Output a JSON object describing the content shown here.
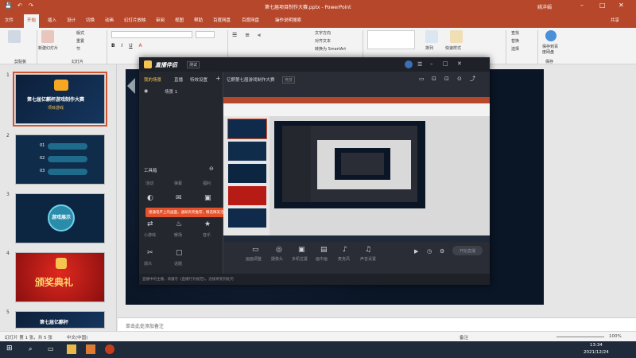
{
  "window": {
    "title": "第七届项目制作大赛.pptx - PowerPoint",
    "user": "姚洋娟"
  },
  "ribbon_tabs": [
    "文件",
    "开始",
    "插入",
    "设计",
    "切换",
    "动画",
    "幻灯片放映",
    "审阅",
    "视图",
    "帮助",
    "百度网盘",
    "百度网盘",
    "操作说明搜索"
  ],
  "ribbon_share": "共享",
  "ribbon_groups": {
    "clipboard": "剪贴板",
    "slides": "幻灯片",
    "new_slide": "新建幻灯片",
    "layout": "版式",
    "reset": "重置",
    "section": "节",
    "text_direction": "文字方向",
    "align_text": "对齐文本",
    "smartart": "转换为 SmartArt",
    "arrange": "排列",
    "quick_styles": "快速样式",
    "find": "查找",
    "replace": "替换",
    "select": "选择",
    "save_baidu": "保存到百度网盘",
    "baidu_group": "保存"
  },
  "thumbs": [
    {
      "num": "1",
      "title": "第七届亿麒杯游戏制作大赛",
      "sub": "项目游戏"
    },
    {
      "num": "2",
      "items": [
        "01",
        "02",
        "03"
      ]
    },
    {
      "num": "3",
      "title": "游戏展示"
    },
    {
      "num": "4",
      "title": "颁奖典礼"
    },
    {
      "num": "5",
      "title": "第七届亿麒杯"
    }
  ],
  "notes_placeholder": "单击此处添加备注",
  "status": {
    "slide_counter": "幻灯片 第 1 张，共 5 张",
    "language": "中文(中国)",
    "notes_label": "备注",
    "zoom": "100%"
  },
  "taskbar": {
    "time": "13:34",
    "date": "2021/12/24"
  },
  "app": {
    "logo": "直播伴侣",
    "version": "测试",
    "side_tabs": [
      "我的场景",
      "直播",
      "特效设置"
    ],
    "scene": "场景 1",
    "room_title": "亿麒第七届游戏制作大赛",
    "room_badge": "竞技",
    "toolbox_label": "工具箱",
    "tools": [
      {
        "label": "活动",
        "icon": "activity-icon"
      },
      {
        "label": "弹幕",
        "icon": "danmu-icon"
      },
      {
        "label": "福利",
        "icon": "gift-icon"
      },
      {
        "label": "小游戏",
        "icon": "game-icon"
      },
      {
        "label": "暖场",
        "icon": "warmup-icon"
      },
      {
        "label": "音乐",
        "icon": "music-icon"
      },
      {
        "label": "观众",
        "icon": "viewer-icon"
      },
      {
        "label": "话题",
        "icon": "topic-icon"
      },
      {
        "label": "分享",
        "icon": "share-icon"
      }
    ],
    "tip_banner": "接通电平上的画面，通知有奖推荐，精选精美活动收益",
    "bottom_tools": [
      "画面调整",
      "摄像头",
      "多机位置",
      "画中画",
      "麦克风",
      "声音设置"
    ],
    "status_text": "直播中的主播，请遵守《直播行为规范》，违规将受到处罚",
    "go_live": "开始直播"
  }
}
